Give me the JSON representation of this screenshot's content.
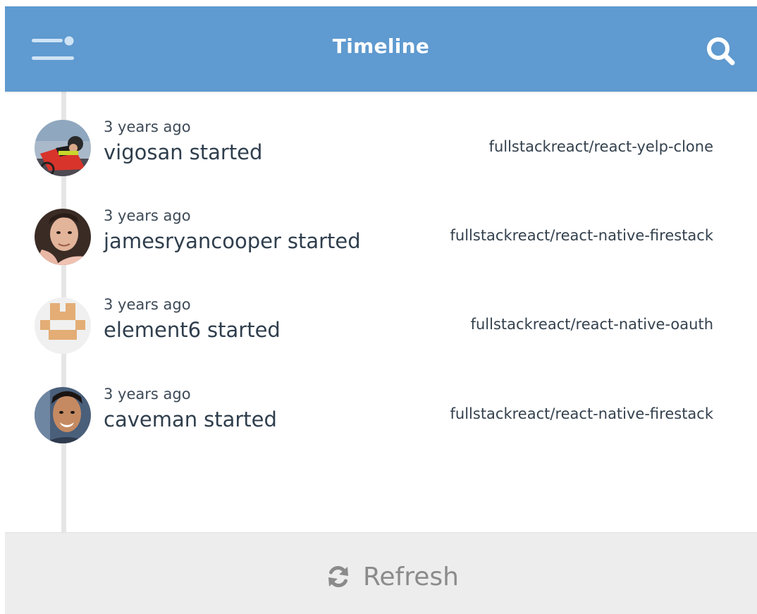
{
  "header": {
    "title": "Timeline",
    "color": "#5f9ad0",
    "menu_icon": "menu-icon",
    "search_icon": "search-icon"
  },
  "feed": {
    "items": [
      {
        "time": "3 years ago",
        "actor": "vigosan",
        "action": "started",
        "repo": "fullstackreact/react-yelp-clone",
        "avatar": "cyclist-photo"
      },
      {
        "time": "3 years ago",
        "actor": "jamesryancooper",
        "action": "started",
        "repo": "fullstackreact/react-native-firestack",
        "avatar": "portrait-photo"
      },
      {
        "time": "3 years ago",
        "actor": "element6",
        "action": "started",
        "repo": "fullstackreact/react-native-oauth",
        "avatar": "identicon"
      },
      {
        "time": "3 years ago",
        "actor": "caveman",
        "action": "started",
        "repo": "fullstackreact/react-native-firestack",
        "avatar": "smiling-portrait-photo"
      }
    ]
  },
  "footer": {
    "refresh_label": "Refresh",
    "refresh_icon": "refresh-icon"
  }
}
